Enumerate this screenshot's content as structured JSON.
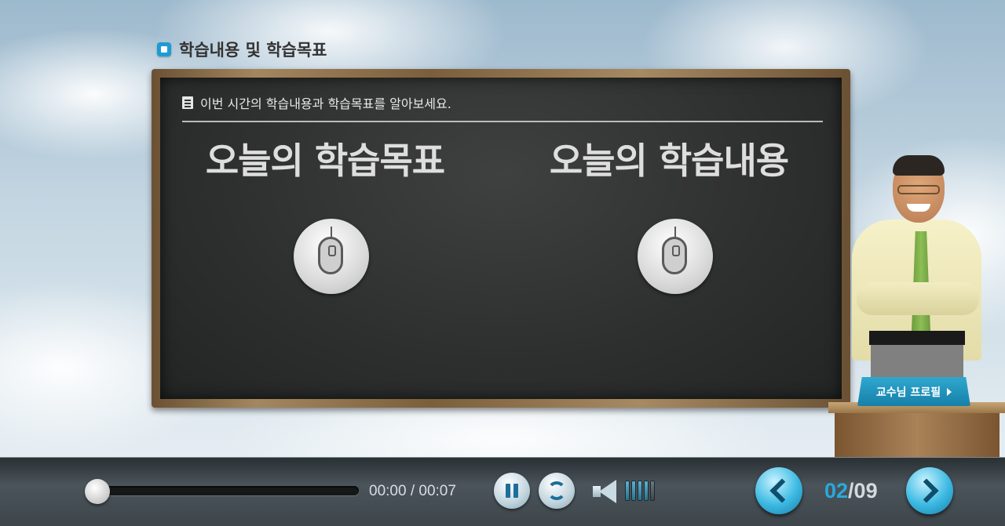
{
  "header": {
    "title": "학습내용 및 학습목표",
    "title_icon": "square-bullet-icon"
  },
  "board": {
    "intro_text": "이번 시간의 학습내용과 학습목표를 알아보세요.",
    "intro_icon": "document-icon",
    "left_title": "오늘의 학습목표",
    "right_title": "오늘의 학습내용",
    "button_icon": "mouse-icon"
  },
  "professor": {
    "profile_label": "교수님 프로필"
  },
  "player": {
    "time_display": "00:00 / 00:07",
    "progress": 0,
    "volume_level": 4,
    "volume_max": 5
  },
  "pagination": {
    "current": "02",
    "total": "/09"
  },
  "colors": {
    "accent": "#2aa8dc",
    "board": "#2d2e2e",
    "frame": "#a4875f",
    "control_bar": "#3e464b"
  }
}
